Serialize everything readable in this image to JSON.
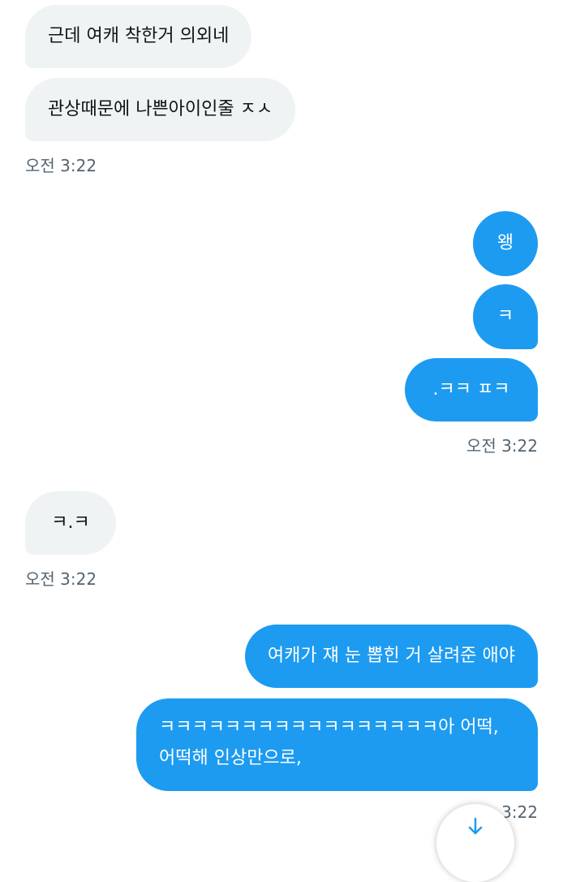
{
  "messages": [
    {
      "side": "in",
      "text": "근데 여캐 착한거 의외네"
    },
    {
      "side": "in",
      "text": "관상때문에 나쁜아이인줄 ㅈㅅ"
    },
    {
      "side": "out",
      "text": "왱"
    },
    {
      "side": "out",
      "text": "ㅋ"
    },
    {
      "side": "out",
      "text": ".ㅋㅋ ㅍㅋ"
    },
    {
      "side": "in",
      "text": "ㅋ.ㅋ"
    },
    {
      "side": "out",
      "text": "여캐가 쟤 눈 뽑힌 거 살려준 애야"
    },
    {
      "side": "out",
      "line1": "ㅋㅋㅋㅋㅋㅋㅋㅋㅋㅋㅋㅋㅋㅋㅋㅋㅋ아 어떡,",
      "line2": "어떡해 인상만으로,"
    }
  ],
  "timestamps": {
    "t1": "오전 3:22",
    "t2": "오전 3:22",
    "t3": "오전 3:22",
    "t4": "3:22"
  },
  "colors": {
    "outgoing_bubble": "#1d9bf0",
    "incoming_bubble": "#eff3f4",
    "timestamp": "#536471"
  },
  "scroll_button_icon": "arrow-down-icon"
}
